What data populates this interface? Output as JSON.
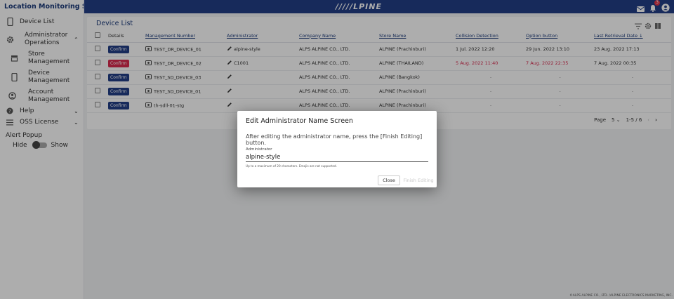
{
  "app": {
    "title": "Location Monitoring System",
    "logo": "/////LPINE",
    "notification_count": "3"
  },
  "sidebar": {
    "device_list": "Device List",
    "admin_ops": "Administrator Operations",
    "store_mgmt": "Store Management",
    "device_mgmt": "Device Management",
    "account_mgmt": "Account Management",
    "help": "Help",
    "oss": "OSS License",
    "alert_popup": "Alert Popup",
    "hide": "Hide",
    "show": "Show"
  },
  "card": {
    "title": "Device List"
  },
  "table": {
    "headers": [
      "Details",
      "Management Number",
      "Administrator",
      "Company Name",
      "Store Name",
      "Collision Detection",
      "Option button",
      "Last Retrieval Date"
    ],
    "confirm_label": "Confirm",
    "rows": [
      {
        "mgmt": "TEST_DR_DEVICE_01",
        "admin": "alpine-style",
        "company": "ALPS ALPINE CO., LTD.",
        "store": "ALPINE (Prachinburi)",
        "collision": "1 Jul. 2022 12:20",
        "option": "29 Jun. 2022 13:10",
        "last": "23 Aug. 2022 17:13",
        "alert": false
      },
      {
        "mgmt": "TEST_DR_DEVICE_02",
        "admin": "C1001",
        "company": "ALPS ALPINE CO., LTD.",
        "store": "ALPINE (THAILAND)",
        "collision": "5 Aug. 2022 11:40",
        "option": "7 Aug. 2022 22:35",
        "last": "7 Aug. 2022 00:35",
        "alert": true
      },
      {
        "mgmt": "TEST_SD_DEVICE_03",
        "admin": "",
        "company": "ALPS ALPINE CO., LTD.",
        "store": "ALPINE (Bangkok)",
        "collision": "-",
        "option": "-",
        "last": "-",
        "alert": false
      },
      {
        "mgmt": "TEST_SD_DEVICE_01",
        "admin": "",
        "company": "ALPS ALPINE CO., LTD.",
        "store": "ALPINE (Prachinburi)",
        "collision": "-",
        "option": "-",
        "last": "-",
        "alert": false
      },
      {
        "mgmt": "th-sdll-01-stg",
        "admin": "",
        "company": "ALPS ALPINE CO., LTD.",
        "store": "ALPINE (Prachinburi)",
        "collision": "-",
        "option": "-",
        "last": "-",
        "alert": false
      }
    ]
  },
  "pager": {
    "label": "Page",
    "size": "5",
    "range": "1-5 / 6"
  },
  "footer": "©ALPS ALPINE CO., LTD. /ALPINE ELECTRONICS MARKETING, INC.",
  "dialog": {
    "title": "Edit Administrator Name Screen",
    "description": "After editing the administrator name, press the [Finish Editing] button.",
    "field_label": "Administrator",
    "field_value": "alpine-style",
    "hint": "Up to a maximum of 20 characters. Emojis are not supported.",
    "close": "Close",
    "finish": "Finish Editing"
  },
  "colors": {
    "brand": "#233e86",
    "alert": "#d92b4f"
  }
}
